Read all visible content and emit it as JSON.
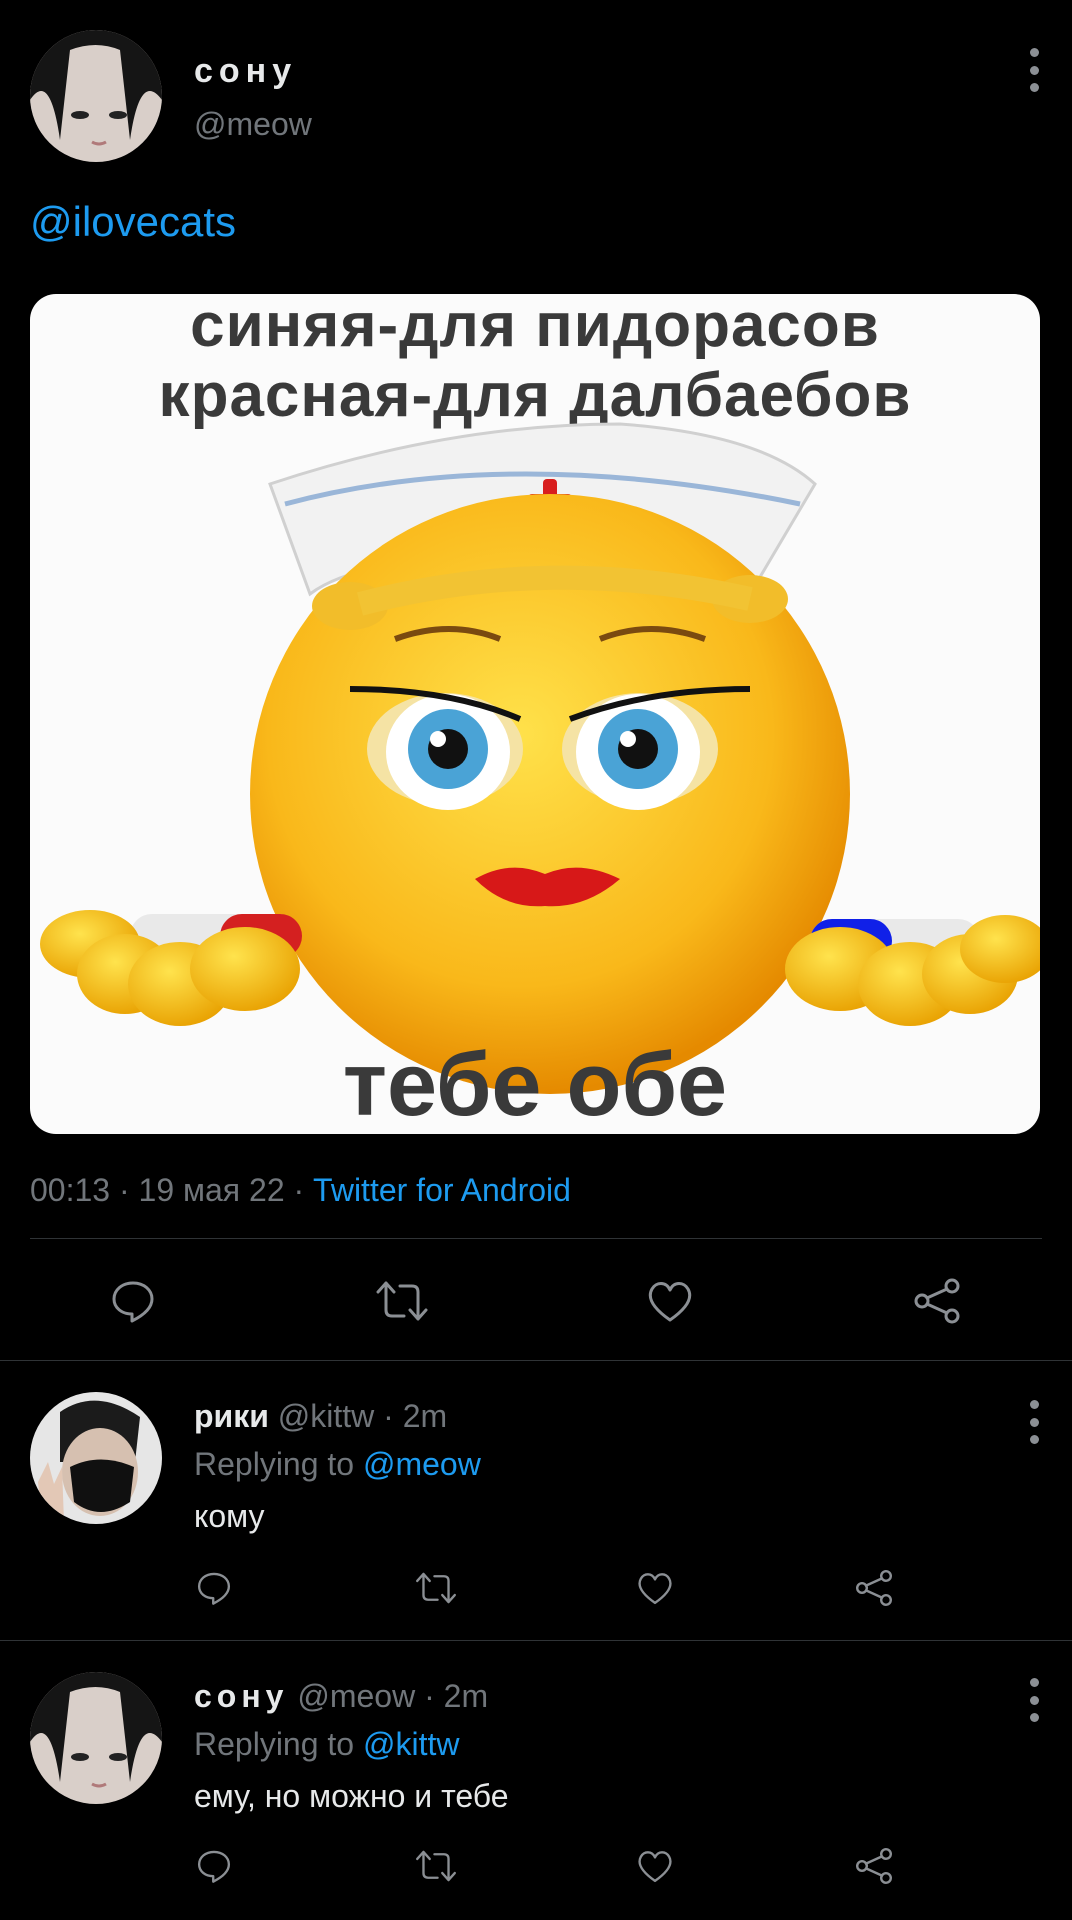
{
  "main_tweet": {
    "author_name": "сону",
    "author_handle": "@meow",
    "mention": "@ilovecats",
    "meme": {
      "top_line1": "синяя-для пидорасов",
      "top_line2": "красная-для далбаебов",
      "bottom_text": "тебе обе"
    },
    "time": "00:13",
    "date": "19 мая 22",
    "sep": "·",
    "client": "Twitter for Android"
  },
  "replies": [
    {
      "author_name": "рики",
      "author_handle": "@kittw",
      "time": "· 2m",
      "replying_label": "Replying to",
      "replying_to": "@meow",
      "text": "кому"
    },
    {
      "author_name": "сону",
      "author_handle": "@meow",
      "time": "· 2m",
      "replying_label": "Replying to",
      "replying_to": "@kittw",
      "text": "ему, но можно и тебе"
    }
  ],
  "icons": [
    "reply-icon",
    "retweet-icon",
    "like-icon",
    "share-icon",
    "more-options-icon"
  ],
  "colors": {
    "background": "#000000",
    "link": "#1d9bf0",
    "muted": "#71767b"
  }
}
